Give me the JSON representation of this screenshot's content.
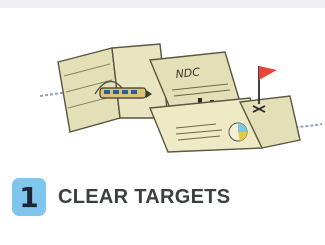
{
  "step": {
    "number": "1",
    "title": "CLEAR TARGETS"
  },
  "illustration": {
    "document_label": "NDC",
    "icons": [
      "folded-map-document",
      "train-icon",
      "flag-icon",
      "pie-chart-icon",
      "route-line"
    ]
  },
  "colors": {
    "badge": "#7ec6ee",
    "title_text": "#3a3f45",
    "paper": "#e3dfb6",
    "flag": "#e8463a",
    "route": "#8fa2b8"
  }
}
